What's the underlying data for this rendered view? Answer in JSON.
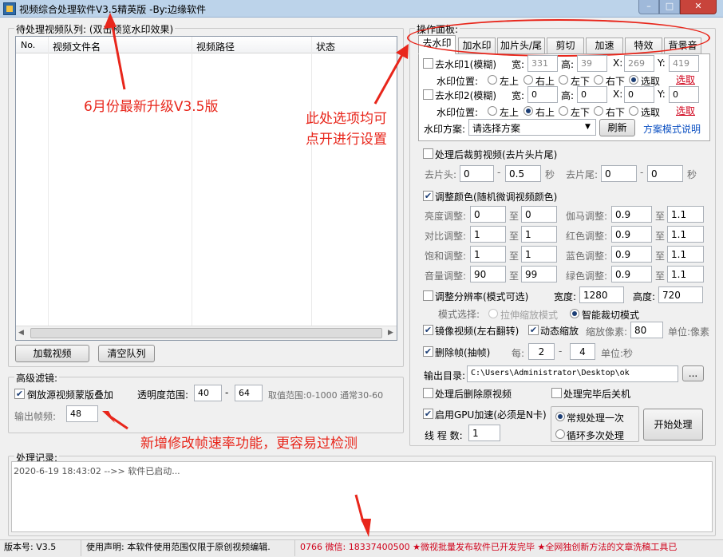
{
  "window": {
    "title": "视频综合处理软件V3.5精英版 -By:边缘软件",
    "min": "–",
    "max": "□",
    "close": "✕"
  },
  "queue": {
    "title": "待处理视频队列: (双击预览水印效果)",
    "columns": [
      "No.",
      "视频文件名",
      "视频路径",
      "状态"
    ],
    "load_button": "加载视频",
    "clear_button": "清空队列"
  },
  "filter": {
    "title": "高级滤镜:",
    "reverse_overlay": {
      "label": "倒放源视频蒙版叠加",
      "checked": true
    },
    "opacity_label": "透明度范围:",
    "opacity_min": "40",
    "opacity_sep": "-",
    "opacity_max": "64",
    "range_hint": "取值范围:0-1000 通常30-60",
    "fps_label": "输出帧频:",
    "fps_value": "48"
  },
  "panel": {
    "title": "操作面板:",
    "tabs": [
      "去水印",
      "加水印",
      "加片头/尾",
      "剪切",
      "加速",
      "特效",
      "背景音"
    ],
    "wm1": {
      "label": "去水印1(模糊)",
      "w_label": "宽:",
      "w": "331",
      "h_label": "高:",
      "h": "39",
      "x_label": "X:",
      "x": "269",
      "y_label": "Y:",
      "y": "419"
    },
    "wm1_pos": {
      "label": "水印位置:",
      "options": [
        "左上",
        "右上",
        "左下",
        "右下",
        "选取"
      ],
      "selected": 4,
      "pick": "选取"
    },
    "wm2": {
      "label": "去水印2(模糊)",
      "w_label": "宽:",
      "w": "0",
      "h_label": "高:",
      "h": "0",
      "x_label": "X:",
      "x": "0",
      "y_label": "Y:",
      "y": "0"
    },
    "wm2_pos": {
      "label": "水印位置:",
      "options": [
        "左上",
        "右上",
        "左下",
        "右下",
        "选取"
      ],
      "selected": 1,
      "pick": "选取"
    },
    "scheme": {
      "label": "水印方案:",
      "value": "请选择方案",
      "refresh": "刷新",
      "help": "方案模式说明"
    }
  },
  "trim": {
    "label": "处理后裁剪视频(去片头片尾)",
    "head_label": "去片头:",
    "head_start": "0",
    "head_end": "0.5",
    "sep": "-",
    "unit": "秒",
    "tail_label": "去片尾:",
    "tail_start": "0",
    "tail_end": "0"
  },
  "color": {
    "label": "调整颜色(随机微调视频颜色)",
    "to": "至",
    "rows": [
      {
        "left_label": "亮度调整:",
        "l1": "0",
        "l2": "0",
        "right_label": "伽马调整:",
        "r1": "0.9",
        "r2": "1.1"
      },
      {
        "left_label": "对比调整:",
        "l1": "1",
        "l2": "1",
        "right_label": "红色调整:",
        "r1": "0.9",
        "r2": "1.1"
      },
      {
        "left_label": "饱和调整:",
        "l1": "1",
        "l2": "1",
        "right_label": "蓝色调整:",
        "r1": "0.9",
        "r2": "1.1"
      },
      {
        "left_label": "音量调整:",
        "l1": "90",
        "l2": "99",
        "right_label": "绿色调整:",
        "r1": "0.9",
        "r2": "1.1"
      }
    ]
  },
  "resolution": {
    "label": "调整分辨率(模式可选)",
    "width_label": "宽度:",
    "width": "1280",
    "height_label": "高度:",
    "height": "720",
    "mode_label": "模式选择:",
    "mode_stretch": "拉伸缩放模式",
    "mode_crop": "智能裁切模式"
  },
  "mirror": {
    "label": "镜像视频(左右翻转)",
    "zoom_label": "动态缩放",
    "zoom_px_label": "缩放像素:",
    "zoom_px": "80",
    "unit_label": "单位:像素"
  },
  "dropframe": {
    "label": "删除帧(抽帧)",
    "every_label": "每:",
    "from": "2",
    "sep": "-",
    "to": "4",
    "unit_label": "单位:秒"
  },
  "output": {
    "label": "输出目录:",
    "path": "C:\\Users\\Administrator\\Desktop\\ok",
    "browse": "..."
  },
  "post": {
    "delete_source": "处理后删除原视频",
    "shutdown": "处理完毕后关机"
  },
  "gpu": {
    "label": "启用GPU加速(必须是N卡)",
    "threads_label": "线 程 数:",
    "threads": "1"
  },
  "run": {
    "mode_once": "常规处理一次",
    "mode_loop": "循环多次处理",
    "start": "开始处理"
  },
  "log": {
    "title": "处理记录:",
    "entries": [
      "2020-6-19 18:43:02 -->> 软件已启动..."
    ]
  },
  "status": {
    "version": "版本号: V3.5",
    "notice": "使用声明: 本软件使用范围仅限于原创视频编辑.",
    "marquee": "0766 微信: 18337400500 ★微视批量发布软件已开发完毕 ★全网独创新方法的文章洗稿工具已"
  },
  "annotations": {
    "update": "6月份最新升级V3.5版",
    "options": [
      "此处选项均可",
      "点开进行设置"
    ],
    "fps": "新增修改帧速率功能，更容易过检测"
  },
  "colors": {
    "accent": "#1c3e75",
    "annotation": "#e8261b",
    "link": "#d0021b",
    "status_text": "#d0021b"
  }
}
